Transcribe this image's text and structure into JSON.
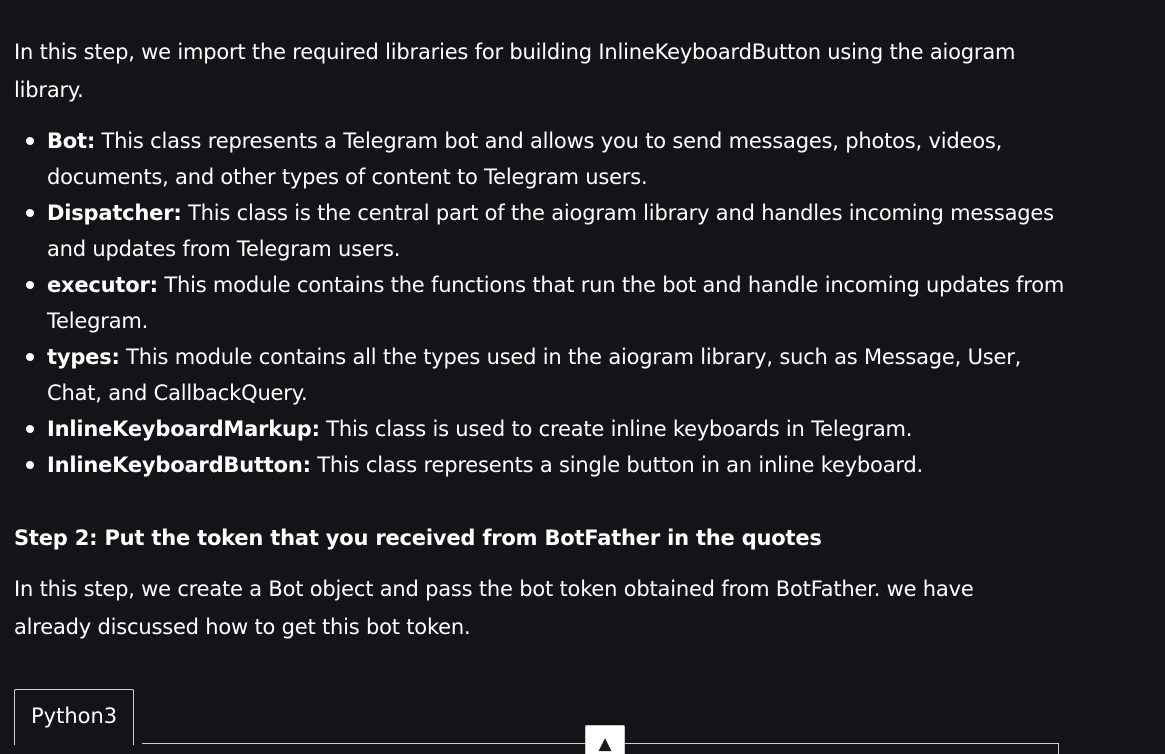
{
  "intro": {
    "text": "In this step, we import the required libraries for building InlineKeyboardButton using the aiogram library."
  },
  "libraries": [
    {
      "name": "Bot:",
      "desc": " This class represents a Telegram bot and allows you to send messages, photos, videos, documents, and other types of content to Telegram users."
    },
    {
      "name": "Dispatcher:",
      "desc": " This class is the central part of the aiogram library and handles incoming messages and updates from Telegram users."
    },
    {
      "name": "executor:",
      "desc": " This module contains the functions that run the bot and handle incoming updates from Telegram."
    },
    {
      "name": "types:",
      "desc": " This module contains all the types used in the aiogram library, such as Message, User, Chat, and CallbackQuery."
    },
    {
      "name": "InlineKeyboardMarkup:",
      "desc": " This class is used to create inline keyboards in Telegram."
    },
    {
      "name": "InlineKeyboardButton:",
      "desc": " This class represents a single button in an inline keyboard."
    }
  ],
  "step2": {
    "heading": "Step 2: Put the token that you received from BotFather in the quotes",
    "text": "In this step, we create a Bot object and pass the bot token obtained from BotFather. we have already discussed how to get this bot token."
  },
  "code_block": {
    "tab_label": "Python3"
  },
  "scroll_top": {
    "icon": "▲",
    "icon_name": "arrow-up-icon"
  }
}
